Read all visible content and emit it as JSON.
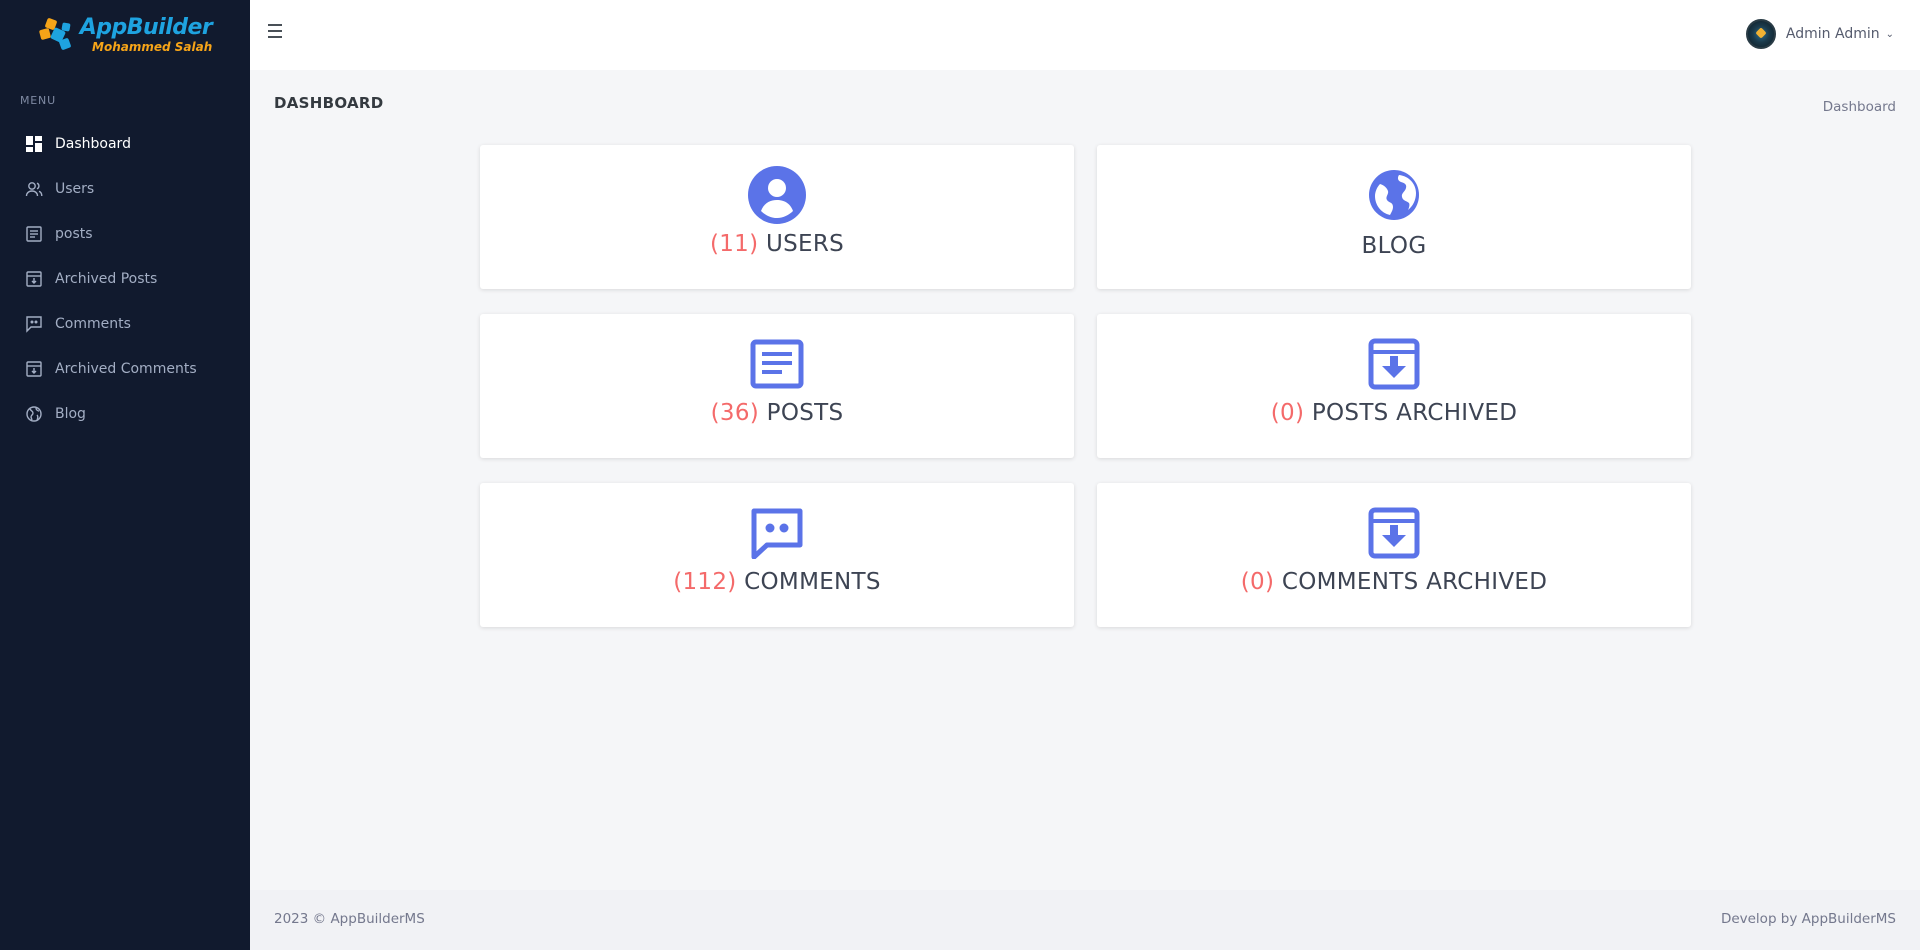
{
  "brand": {
    "title": "AppBuilder",
    "subtitle": "Mohammed Salah"
  },
  "sidebar": {
    "menu_title": "MENU",
    "items": [
      {
        "label": "Dashboard",
        "icon": "dashboard-icon",
        "active": true
      },
      {
        "label": "Users",
        "icon": "users-icon"
      },
      {
        "label": "posts",
        "icon": "posts-icon"
      },
      {
        "label": "Archived Posts",
        "icon": "archive-icon"
      },
      {
        "label": "Comments",
        "icon": "comments-icon"
      },
      {
        "label": "Archived Comments",
        "icon": "archive-icon"
      },
      {
        "label": "Blog",
        "icon": "globe-icon"
      }
    ]
  },
  "topbar": {
    "user_name": "Admin Admin",
    "chevron": "⌄"
  },
  "page": {
    "title": "DASHBOARD",
    "breadcrumb": "Dashboard"
  },
  "cards": {
    "users": {
      "count": "(11)",
      "label": "USERS",
      "icon": "user-circle-icon"
    },
    "blog": {
      "label": "BLOG",
      "icon": "globe-icon"
    },
    "posts": {
      "count": "(36)",
      "label": "POSTS",
      "icon": "document-icon"
    },
    "posts_archived": {
      "count": "(0)",
      "label": "POSTS ARCHIVED",
      "icon": "archive-icon"
    },
    "comments": {
      "count": "(112)",
      "label": "COMMENTS",
      "icon": "comment-icon"
    },
    "comments_archived": {
      "count": "(0)",
      "label": "COMMENTS ARCHIVED",
      "icon": "archive-icon"
    }
  },
  "footer": {
    "left": "2023 © AppBuilderMS",
    "right": "Develop by AppBuilderMS"
  },
  "colors": {
    "sidebar_bg": "#111a2e",
    "accent": "#5b73e8",
    "count": "#f46a6a"
  }
}
